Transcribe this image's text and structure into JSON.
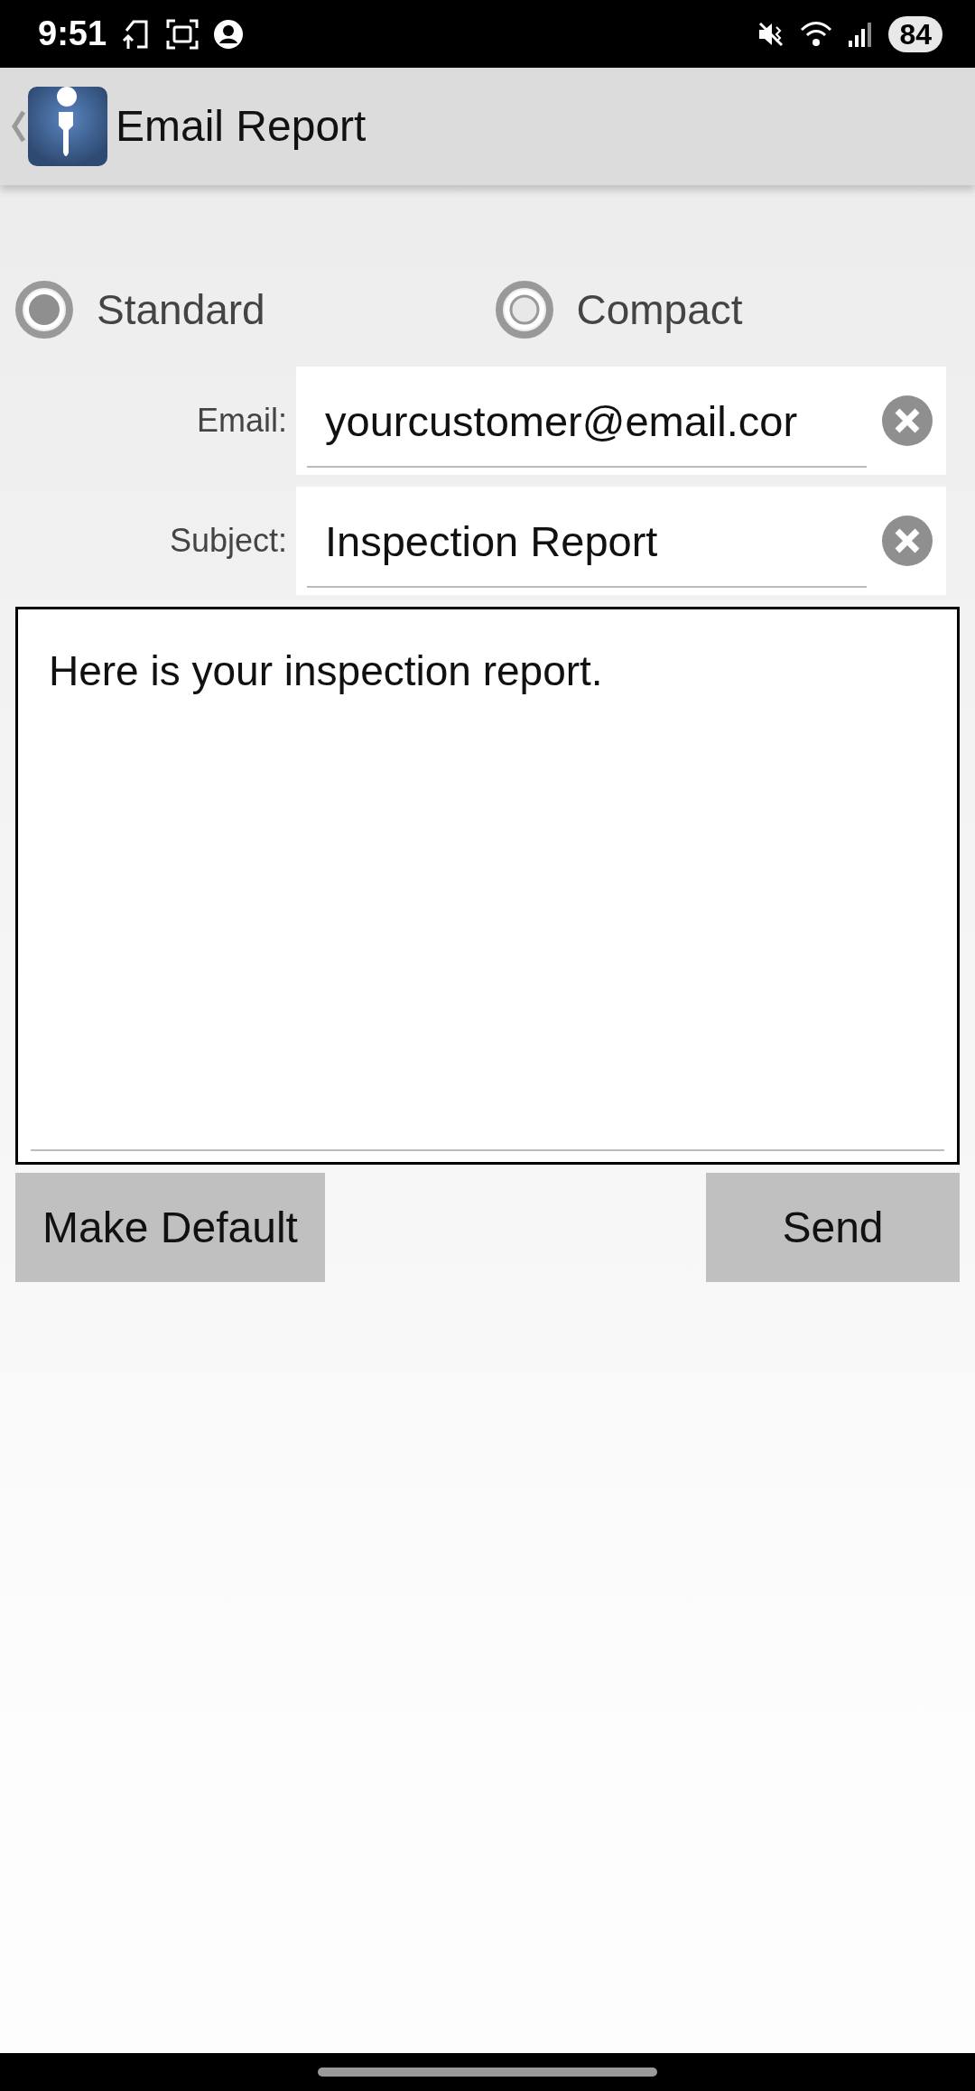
{
  "status_bar": {
    "time": "9:51",
    "battery": "84"
  },
  "header": {
    "title": "Email Report"
  },
  "format_options": [
    {
      "label": "Standard",
      "selected": true
    },
    {
      "label": "Compact",
      "selected": false
    }
  ],
  "fields": [
    {
      "label": "Email:",
      "value": "yourcustomer@email.cor"
    },
    {
      "label": "Subject:",
      "value": "Inspection Report"
    }
  ],
  "message": {
    "value": "Here is your inspection report."
  },
  "buttons": [
    {
      "label": "Make Default"
    },
    {
      "label": "Send"
    }
  ]
}
